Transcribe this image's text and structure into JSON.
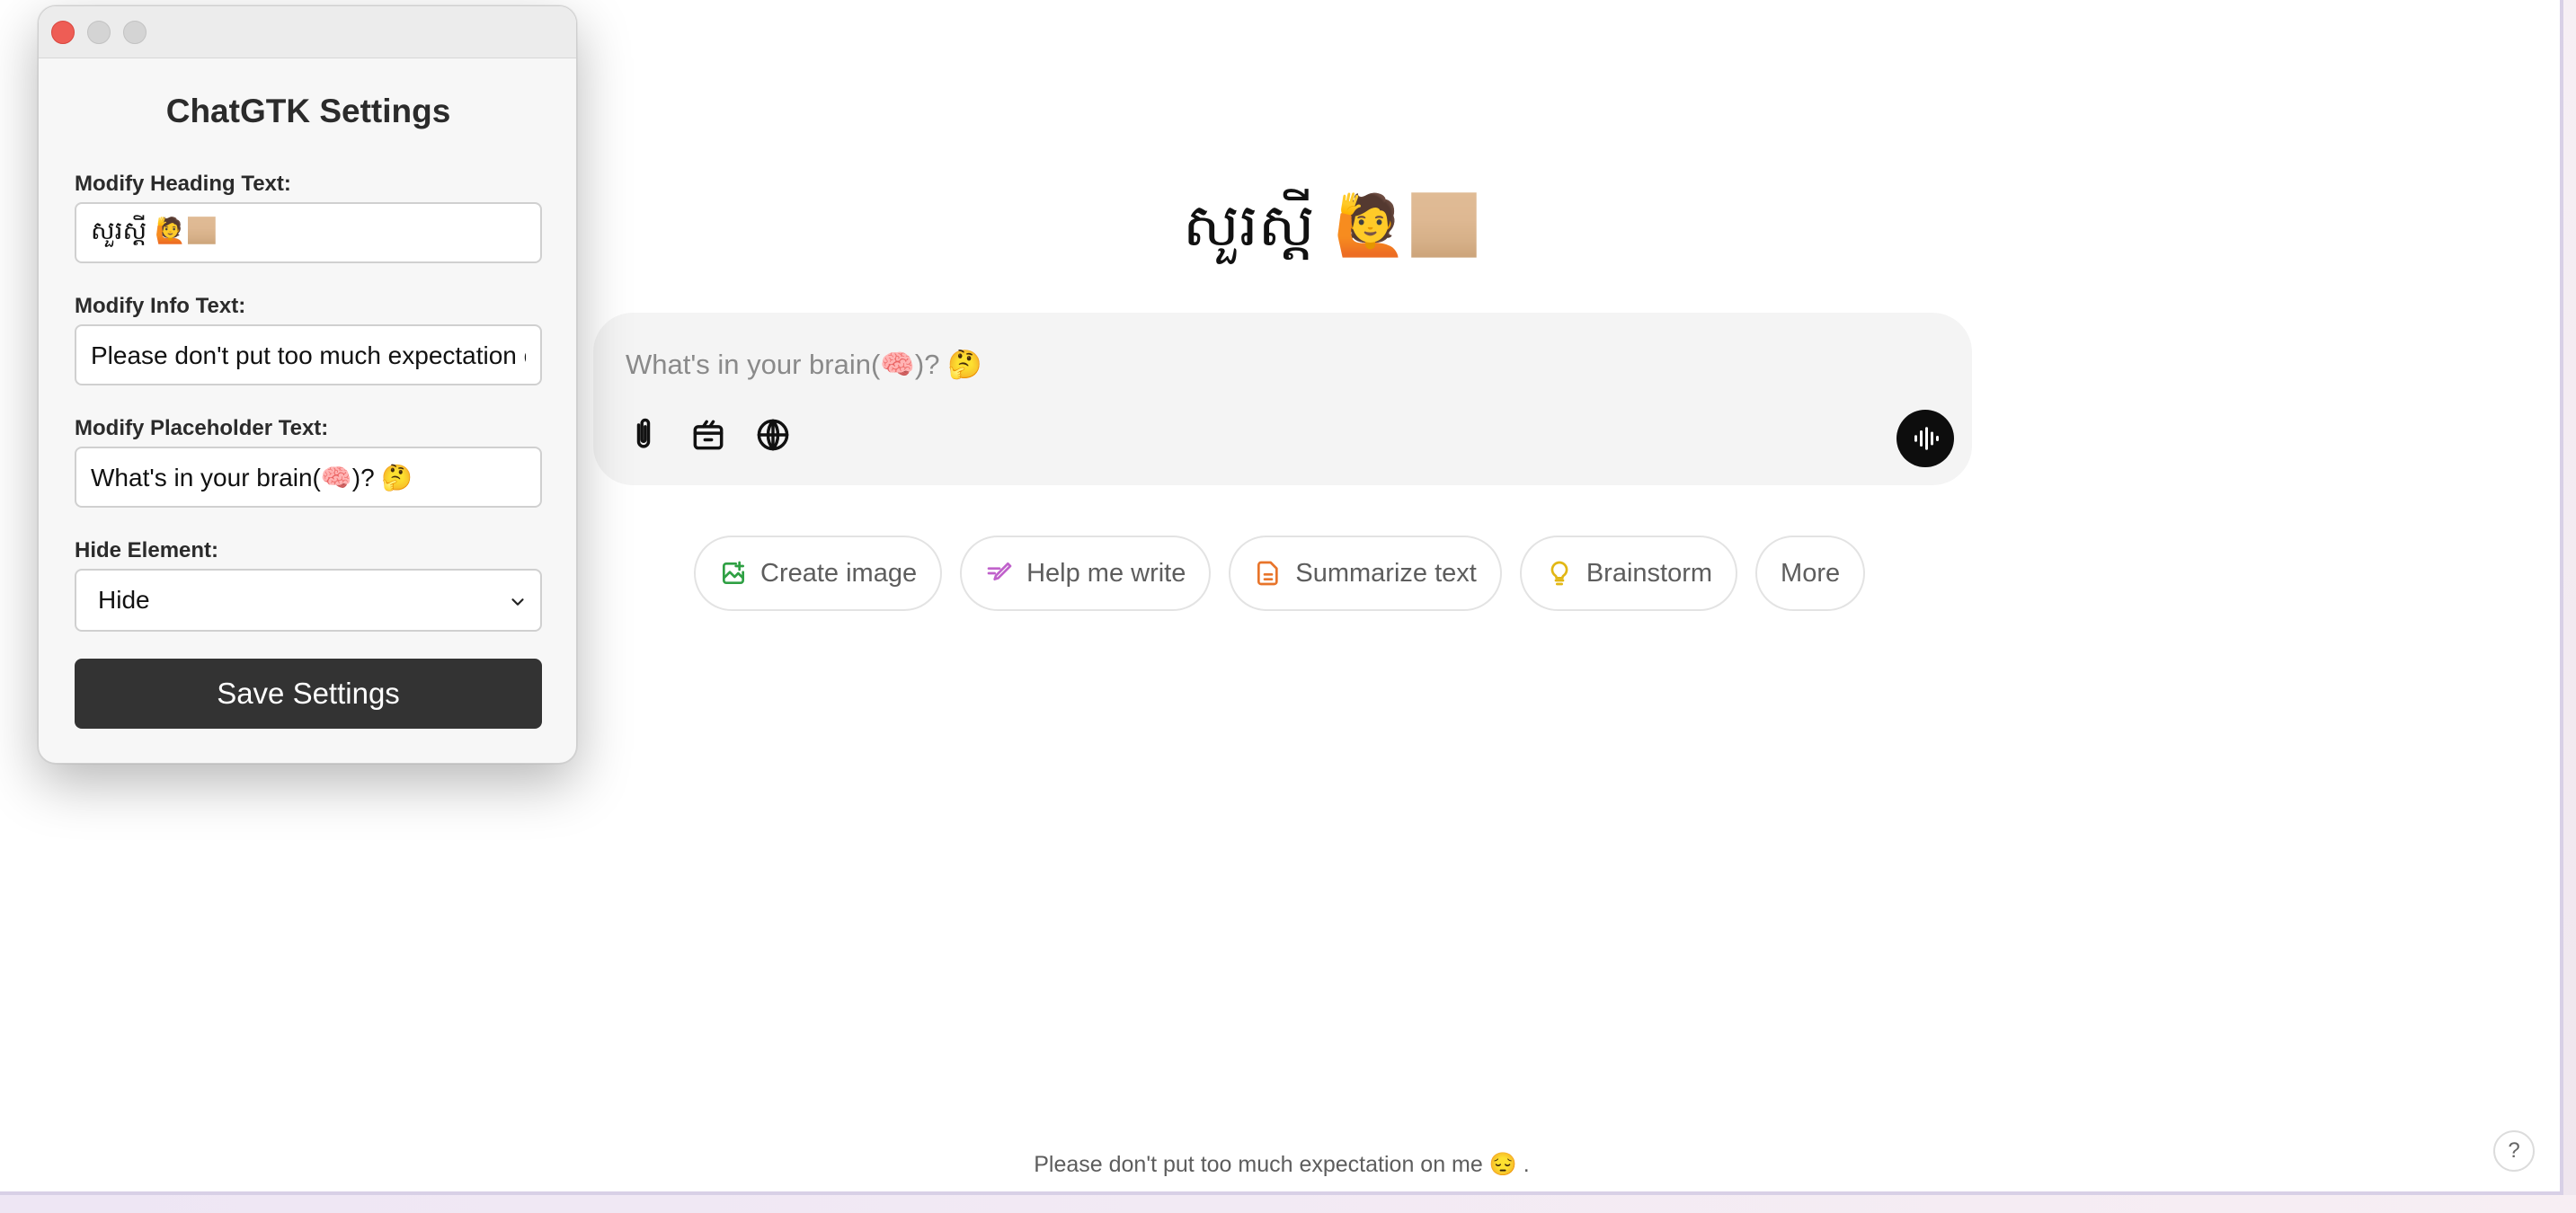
{
  "main": {
    "heading": "សួរស្តី 🙋🏼",
    "composer": {
      "placeholder": "What's in your brain(🧠)? 🤔"
    },
    "tools": [
      {
        "icon": "paperclip-icon"
      },
      {
        "icon": "toolbox-icon"
      },
      {
        "icon": "globe-icon"
      }
    ],
    "voice_icon": "voice-waveform-icon",
    "suggestions": [
      {
        "label": "Create image",
        "icon": "image-icon",
        "color": "#2ea043"
      },
      {
        "label": "Help me write",
        "icon": "pen-icon",
        "color": "#c061cb"
      },
      {
        "label": "Summarize text",
        "icon": "document-icon",
        "color": "#e8742a"
      },
      {
        "label": "Brainstorm",
        "icon": "lightbulb-icon",
        "color": "#e2b714"
      },
      {
        "label": "More"
      }
    ],
    "info_text": "Please don't put too much expectation on me 😔 .",
    "help_label": "?"
  },
  "settings": {
    "title": "ChatGTK Settings",
    "heading_label": "Modify Heading Text:",
    "heading_value": "សួរស្តី 🙋🏼",
    "info_label": "Modify Info Text:",
    "info_value": "Please don't put too much expectation on me 😔 .",
    "placeholder_label": "Modify Placeholder Text:",
    "placeholder_value": "What's in your brain(🧠)? 🤔",
    "hide_label": "Hide Element:",
    "hide_value": "Hide",
    "save_label": "Save Settings"
  }
}
